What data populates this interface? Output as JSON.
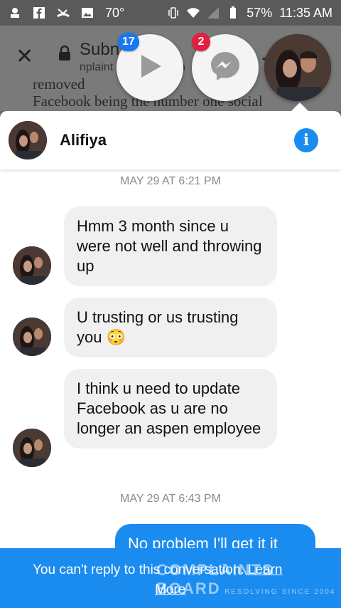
{
  "status_bar": {
    "temperature": "70°",
    "battery": "57%",
    "time": "11:35 AM"
  },
  "browser": {
    "title": "Subn",
    "title_suffix": ".",
    "url": "nplaint",
    "url_suffix": "n",
    "page_line_1": "removed",
    "page_line_2": "Facebook being the number one social"
  },
  "chat_heads": {
    "video_badge": "17",
    "messenger_badge": "2"
  },
  "conversation": {
    "contact_name": "Alifiya",
    "timestamp_1": "MAY 29 AT 6:21 PM",
    "msg_1": "Hmm 3 month since u were not well and throwing up",
    "msg_2": "U trusting or us trusting you 😳",
    "msg_3": "I think u need to update Facebook as u are no longer an aspen employee",
    "timestamp_2": "MAY 29 AT 6:43 PM",
    "outgoing_1": "No problem I'll get it it"
  },
  "footer": {
    "text": "You can't reply to this conversation.",
    "link_1": "Learn",
    "link_2": "More"
  },
  "watermark": {
    "line1": "COMPLAINTS",
    "line2": "BOARD",
    "line3": "RESOLVING",
    "line4": "SINCE 2004"
  },
  "colors": {
    "accent": "#1a8cf0",
    "badge_blue": "#1877f2",
    "badge_red": "#e41e3f"
  }
}
